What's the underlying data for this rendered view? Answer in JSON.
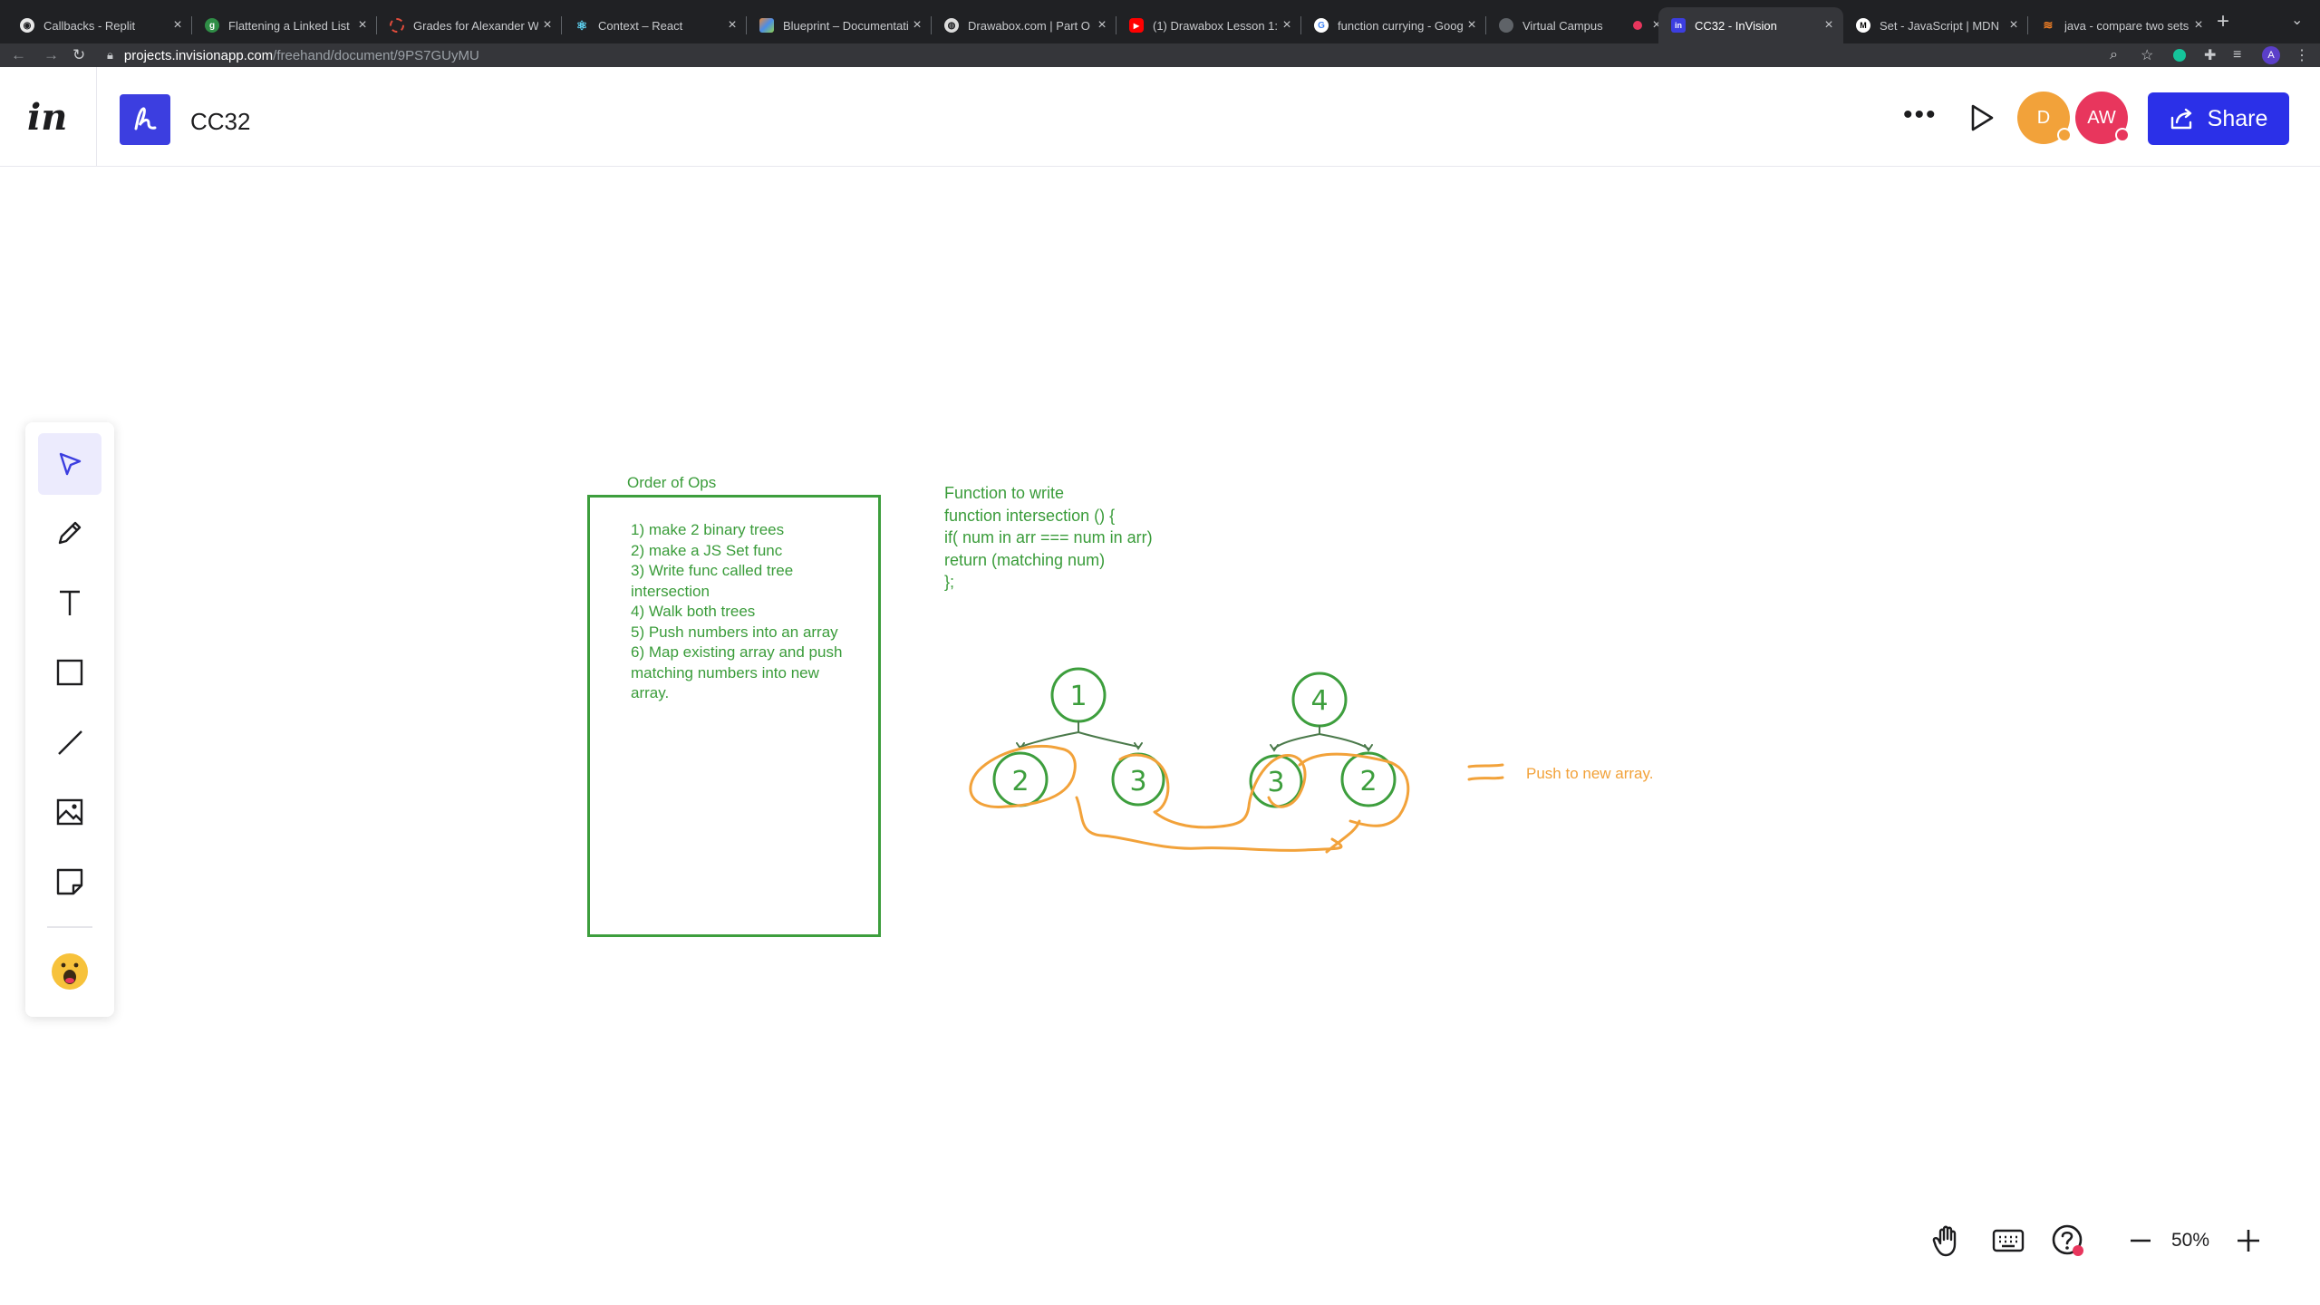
{
  "browser": {
    "tabs": [
      {
        "title": "Callbacks - Replit",
        "fav_color": "#e8e8e8"
      },
      {
        "title": "Flattening a Linked List",
        "fav_color": "#2f8d46"
      },
      {
        "title": "Grades for Alexander W",
        "fav_color": "#e14c3c"
      },
      {
        "title": "Context – React",
        "fav_color": "#61dafb"
      },
      {
        "title": "Blueprint – Documentatio",
        "fav_color": "#e8893a"
      },
      {
        "title": "Drawabox.com | Part O",
        "fav_color": "#dcdcdc"
      },
      {
        "title": "(1) Drawabox Lesson 1:",
        "fav_color": "#ff0000"
      },
      {
        "title": "function currying - Goog",
        "fav_color": "#ffffff"
      },
      {
        "title": "Virtual Campus",
        "fav_color": "#5f6368"
      },
      {
        "title": "CC32 - InVision",
        "fav_color": "#3c3ee0"
      },
      {
        "title": "Set - JavaScript | MDN",
        "fav_color": "#ffffff"
      },
      {
        "title": "java - compare two sets",
        "fav_color": "#f48024"
      }
    ],
    "active_tab": 9,
    "url_host": "projects.invisionapp.com",
    "url_path": "/freehand/document/9PS7GUyMU",
    "profile_initial": "A"
  },
  "app": {
    "logo_text": "in",
    "doc_title": "CC32",
    "avatars": [
      {
        "initials": "D",
        "color": "#f2a23a",
        "status_color": "#f2a23a"
      },
      {
        "initials": "AW",
        "color": "#e8365d",
        "status_color": "#e8365d"
      }
    ],
    "share_label": "Share"
  },
  "toolbar": {
    "tools": [
      "select",
      "pencil",
      "text",
      "rectangle",
      "line",
      "image",
      "sticky-note"
    ],
    "selected": "select",
    "reaction_icon": "emoji-icon"
  },
  "board": {
    "order_title": "Order of Ops",
    "steps": [
      "1) make 2 binary trees",
      "2) make a JS Set func",
      "3) Write func called tree intersection",
      "4) Walk both trees",
      "5) Push numbers into an array",
      "6) Map existing array and push matching numbers into new array."
    ],
    "function_lines": [
      "Function to write",
      "function intersection () {",
      "if( num in arr === num in arr)",
      "return (matching num)",
      "};"
    ],
    "tree1": {
      "root": "1",
      "children": [
        "2",
        "3"
      ]
    },
    "tree2": {
      "root": "4",
      "children": [
        "3",
        "2"
      ]
    },
    "push_label": "Push to new array."
  },
  "footer": {
    "zoom": "50%"
  },
  "colors": {
    "ink_green": "#3d9e3d",
    "ink_orange": "#f2a23a",
    "accent": "#2b30e8"
  }
}
